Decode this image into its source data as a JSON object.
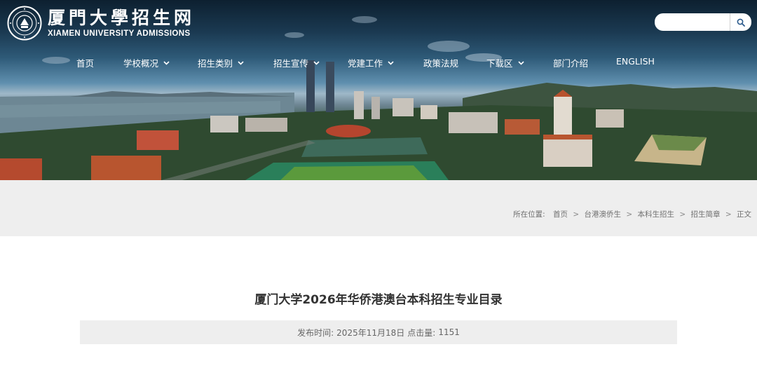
{
  "header": {
    "logo_cn": "厦門大學招生网",
    "logo_en": "XIAMEN UNIVERSITY ADMISSIONS",
    "search": {
      "placeholder": "",
      "value": ""
    }
  },
  "nav": {
    "items": [
      {
        "label": "首页",
        "dropdown": false
      },
      {
        "label": "学校概况",
        "dropdown": true
      },
      {
        "label": "招生类别",
        "dropdown": true
      },
      {
        "label": "招生宣传",
        "dropdown": true
      },
      {
        "label": "党建工作",
        "dropdown": true
      },
      {
        "label": "政策法规",
        "dropdown": false
      },
      {
        "label": "下载区",
        "dropdown": true
      },
      {
        "label": "部门介绍",
        "dropdown": false
      },
      {
        "label": "ENGLISH",
        "dropdown": false
      }
    ]
  },
  "breadcrumb": {
    "prefix": "所在位置:",
    "items": [
      "首页",
      "台港澳侨生",
      "本科生招生",
      "招生简章",
      "正文"
    ],
    "separator": ">"
  },
  "article": {
    "title": "厦门大学2026年华侨港澳台本科招生专业目录",
    "publish_label": "发布时间:",
    "publish_date": "2025年11月18日",
    "hits_label": "点击量:",
    "hits": "1151"
  },
  "colors": {
    "crumb_band": "#eeeeee",
    "title_text": "#333333",
    "meta_text": "#666666",
    "nav_text": "#ffffff"
  }
}
